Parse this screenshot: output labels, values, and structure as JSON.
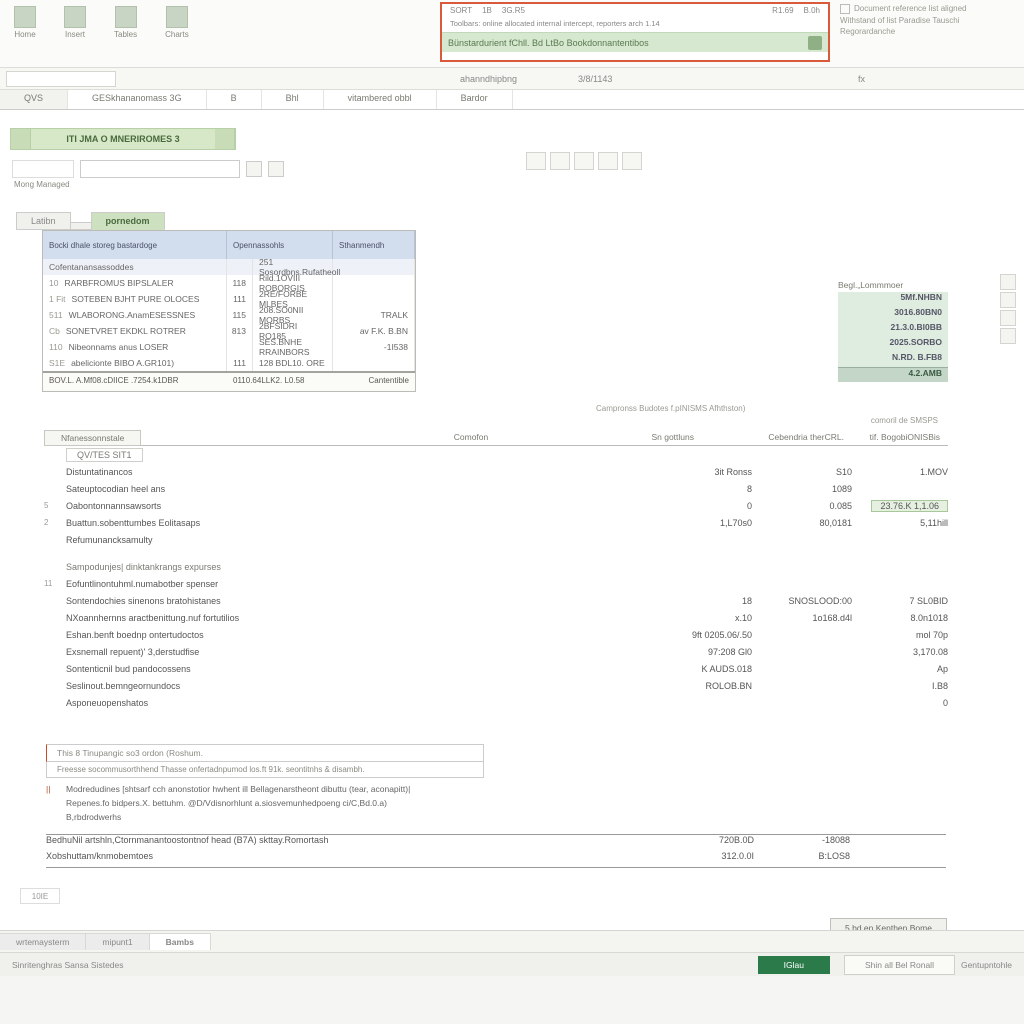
{
  "ribbon": {
    "left_groups": [
      {
        "icon": "home-icon",
        "label": "Home"
      },
      {
        "icon": "insert-icon",
        "label": "Insert"
      },
      {
        "icon": "table-icon",
        "label": "Tables"
      },
      {
        "icon": "chart-icon",
        "label": "Charts"
      }
    ],
    "highlighted": {
      "row1": [
        "SORT",
        "1B",
        "3G.R5",
        "R1.69",
        "B.0h"
      ],
      "row2": "Toolbars: online allocated internal intercept, reporters arch 1.14",
      "row3": "Bünstardurient fChll. Bd LtBo Bookdonnantentibos",
      "sub": "ahanndhipbng"
    },
    "right": {
      "l1": "Document reference list aligned",
      "l2": "Withstand of list Paradise Tauschi",
      "l3": "Regorardanche"
    }
  },
  "formula": {
    "sub": "3/8/1143",
    "fx": "fx"
  },
  "tabs": [
    "QVS",
    "GESkhananomass 3G",
    "B",
    "Bhl",
    "vitambered  obbl",
    "Bardor"
  ],
  "doc_title": "ITI  JMA O MNERIROMES 3",
  "tb2": {
    "label": "",
    "btn_lbl": ""
  },
  "sub_label": "Mong Managed",
  "btns_mid_count": 5,
  "tree": {
    "tab1": "Latibn",
    "tab2": "pornedom",
    "headers": [
      "Bocki dhale storeg bastardoge",
      "Opennassohls",
      "Sthanmendh"
    ],
    "sub_header": [
      "Cofentanansassoddes",
      "251  Sosordbns.Rufatheoll"
    ],
    "rows": [
      {
        "n": "10",
        "a": "RARBFROMUS BIPSLALER",
        "b": "118",
        "c": "Rild.1OVIII  ROBORGIS",
        "d": ""
      },
      {
        "n": "1 Fit",
        "a": "SOTEBEN BJHT PURE OLOCES",
        "b": "111",
        "c": "2RE/FORBE  MLBES",
        "d": ""
      },
      {
        "n": "511",
        "a": "WLABORONG.AnamESESSNES",
        "b": "115",
        "c": "208.SO0NII  MORBS",
        "d": "TRALK"
      },
      {
        "n": "Cb",
        "a": "SONETVRET EKDKL ROTRER",
        "b": "813",
        "c": "2BFSIDRI  RO185",
        "d": "av F.K. B.BN"
      },
      {
        "n": "110",
        "a": "Nibeonnams anus LOSER",
        "b": "",
        "c": "SES.BNHE  RRAINBORS",
        "d": "-1I538"
      },
      {
        "n": "S1E",
        "a": "abelicionte BIBO A.GR101)",
        "b": "111",
        "c": "128 BDL10. ORE",
        "d": ""
      }
    ],
    "foot": {
      "a": "BOV.L. A.Mf08.cDIICE  .7254.k1DBR",
      "b": "0110.64LLK2. L0.58",
      "c": "Cantentible"
    }
  },
  "side": {
    "header": "Begl.„Lommmoer",
    "rows": [
      "5Mf.NHBN",
      "3016.80BN0",
      "21.3.0.Bl0BB",
      "2025.SORBO",
      "N.RD. B.FB8"
    ],
    "total": "4.2.AMB"
  },
  "caption_mid": "Campronss Budotes f.pINISMS Afhthston)",
  "ws": {
    "tab_label": "Nfanessonnstale",
    "col_headers": [
      "Comofon",
      "Sn gottluns",
      "Cebendria therCRL.",
      "tif. BogobiONISBis"
    ],
    "sup_header": "comoril de SMSPS",
    "section1": {
      "h": "QV/TES SIT1",
      "rows": [
        {
          "n": "",
          "d": "Distuntatinancos",
          "v": [
            "3it Ronss",
            "S10",
            "1.MOV"
          ]
        },
        {
          "n": "",
          "d": "Sateuptocodian heel ans",
          "v": [
            "8",
            "1089",
            ""
          ]
        },
        {
          "n": "5",
          "d": "Oabontonnannsawsorts",
          "v": [
            "0",
            "0.085",
            "23.76.K 1,1.06"
          ],
          "hl": true
        },
        {
          "n": "2",
          "d": "Buattun.sobenttumbes Eolitasaps",
          "v": [
            "1,L70s0",
            "80,0181",
            "5,11hill"
          ]
        },
        {
          "n": "",
          "d": "Refumunancksamulty",
          "v": [
            "",
            "",
            ""
          ]
        }
      ]
    },
    "section2": {
      "h": "Sampodunjes| dinktankrangs expurses",
      "rows": [
        {
          "n": "11",
          "d": "Eofuntlinontuhml.numabotber spenser",
          "v": [
            "",
            "",
            ""
          ]
        },
        {
          "n": "",
          "d": "Sontendochies sinenons bratohistanes",
          "v": [
            "18",
            "SNOSLOOD:00",
            "7 SL0BID"
          ]
        },
        {
          "n": "",
          "d": "NXoannhernns aractbenittung.nuf fortutilios",
          "v": [
            "x.10",
            "1o168.d4l",
            "8.0n1018"
          ]
        },
        {
          "n": "",
          "d": "Eshan.benft boednp ontertudoctos",
          "v": [
            "9ft 0205.06/.50",
            "",
            "mol  70p"
          ]
        },
        {
          "n": "",
          "d": "Exsnemall repuent)'  3,derstudfise",
          "v": [
            "97:208 Gl0",
            "",
            "3,170.08"
          ]
        },
        {
          "n": "",
          "d": "Sontenticnil bud pandocossens",
          "v": [
            "K AUDS.018",
            "",
            "Ap"
          ]
        },
        {
          "n": "",
          "d": "Seslinout.bemngeornundocs",
          "v": [
            "ROLOB.BN",
            "",
            "I.B8"
          ]
        },
        {
          "n": "",
          "d": "Asponeuopenshatos",
          "v": [
            "",
            "",
            "0"
          ]
        }
      ]
    },
    "notes": {
      "n1": "This  8 Tinupangic so3 ordon (Roshum.",
      "n2": "Freesse socommusorthhend Thasse onfertadnpumod los.ft  91k. seontitnhs & disambh.",
      "lines": [
        "Modredudines [shtsarf cch anonstotior hwhent ill Bellagenarstheont dibuttu (tear, aconapitt)|",
        "Repenes.fo bidpers.X. bettuhm.  @D/Vdisnorhlunt a.siosvemunhedpoeng ci/C,Bd.0.a)",
        "B,rbdrodwerhs"
      ]
    },
    "footer": [
      {
        "d": "BedhuNil artshln,Ctornmanantoostontnof head (B7A) skttay.Romortash",
        "v": [
          "720B.0D",
          "-18088",
          ""
        ]
      },
      {
        "d": "Xobshuttam/knmobemtoes",
        "v": [
          "312.0.0I",
          "B:LOS8",
          ""
        ]
      }
    ]
  },
  "page": "10IE",
  "bot_btn": "5 bd en Kenthen Bome",
  "sheets": [
    "wrtemaysterm",
    "mipunt1",
    "Bambs"
  ],
  "status": {
    "left": "Sinritenghras Sansa Sistedes",
    "go": "IGlau",
    "mid": "Shin all Bel Ronall",
    "right": "Gentupntohle"
  }
}
